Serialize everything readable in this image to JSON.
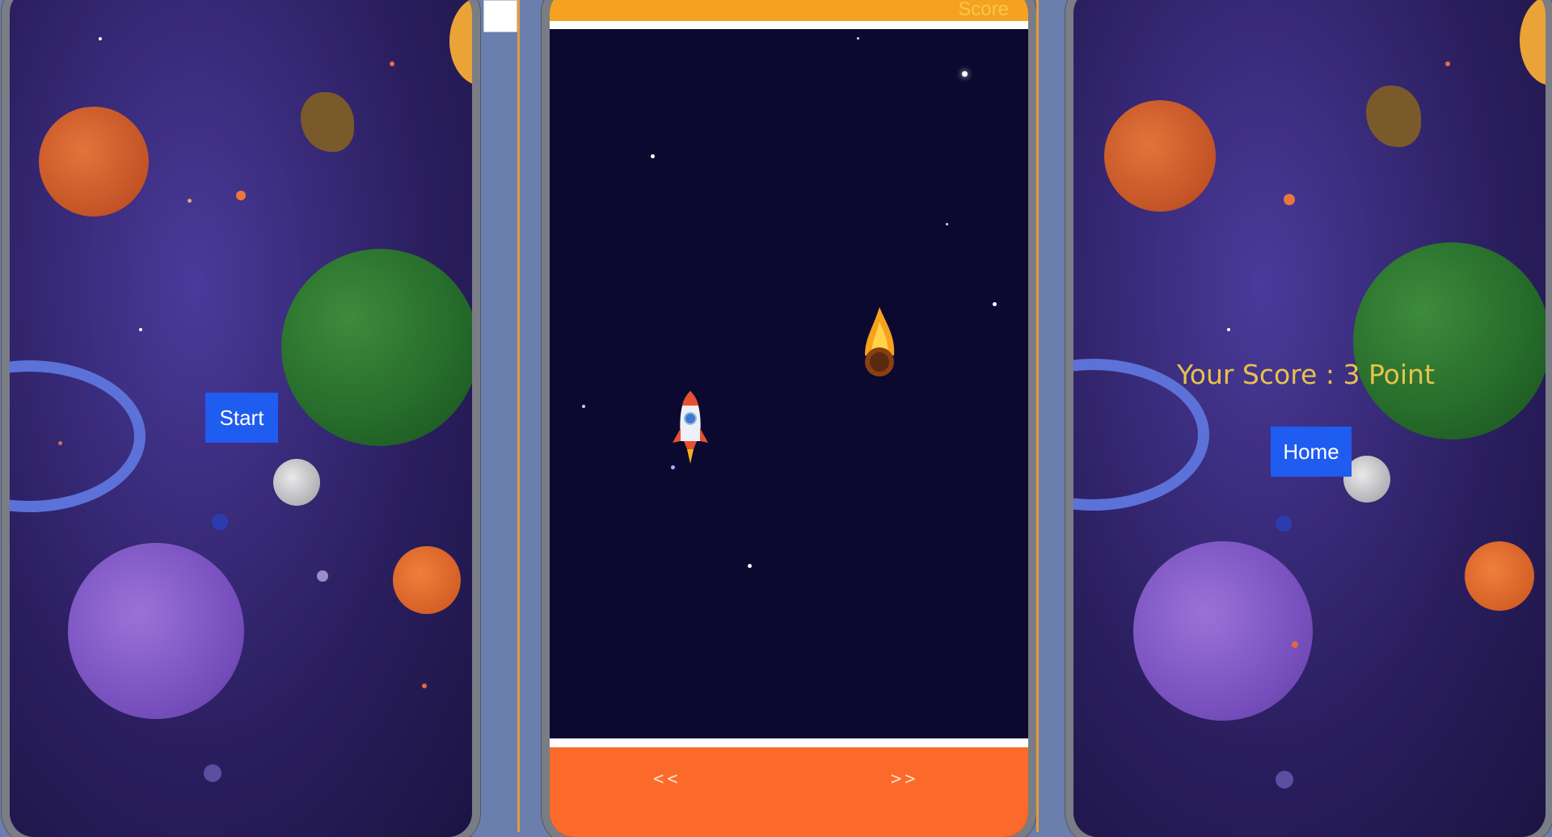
{
  "start_screen": {
    "start_label": "Start"
  },
  "game_screen": {
    "score_label": "Score",
    "left_control": "<<",
    "right_control": ">>"
  },
  "end_screen": {
    "score_text": "Your Score : 3 Point",
    "home_label": "Home"
  },
  "colors": {
    "button_blue": "#1f5cf0",
    "score_gold": "#e8c24a",
    "top_bar": "#f4a21f",
    "bottom_bar": "#fb6a2b",
    "space_bg": "#0b0930"
  },
  "icons": [
    "rocket-icon",
    "meteor-icon",
    "planet-icon",
    "moon-icon",
    "asteroid-icon"
  ]
}
